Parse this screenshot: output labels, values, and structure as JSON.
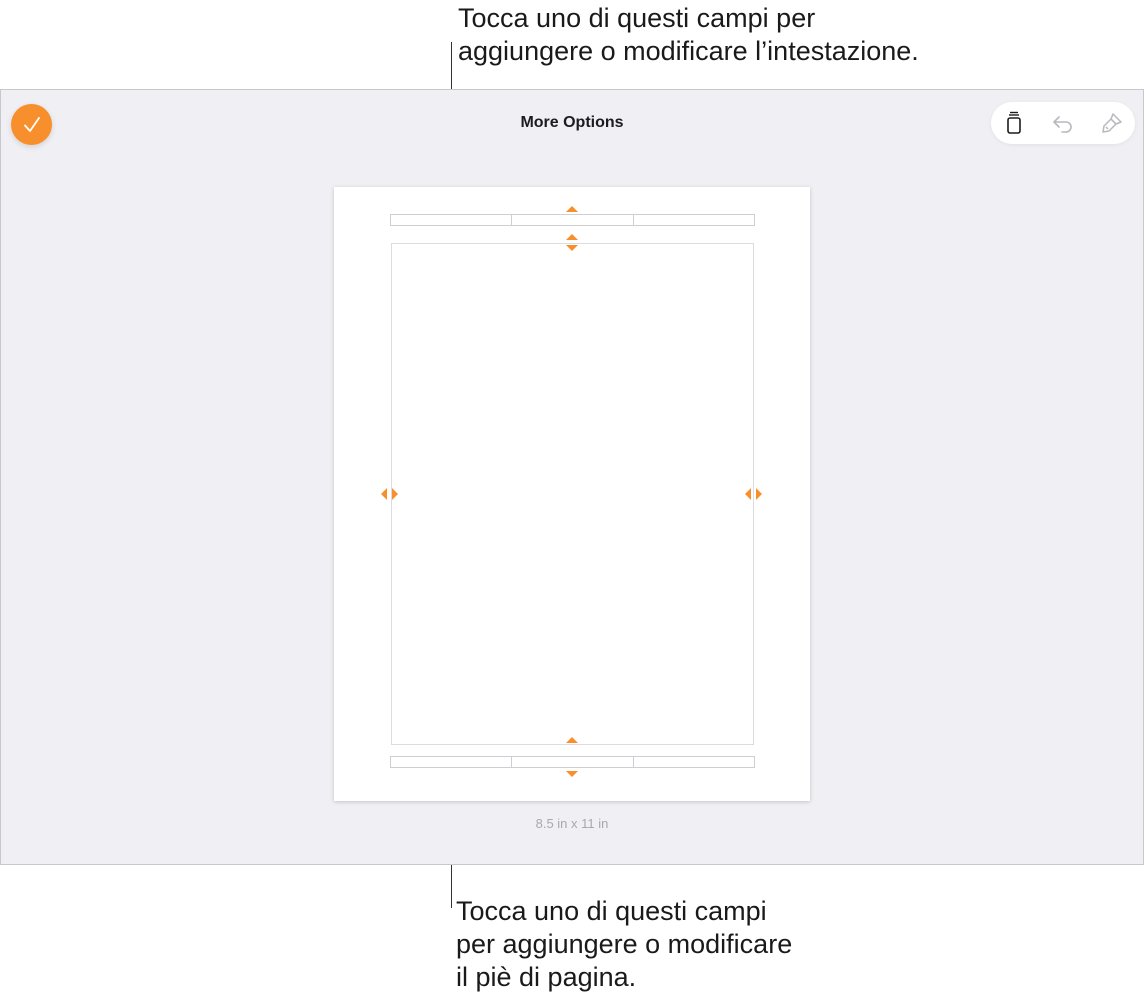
{
  "callouts": {
    "header_line1": "Tocca uno di questi campi per",
    "header_line2": "aggiungere o modificare l’intestazione.",
    "footer_line1": "Tocca uno di questi campi",
    "footer_line2": "per aggiungere o modificare",
    "footer_line3": "il piè di pagina."
  },
  "screen": {
    "title": "More Options",
    "page_size_label": "8.5 in x 11 in",
    "done_icon": "checkmark-icon",
    "toolbar_icons": [
      "clear-document-icon",
      "undo-icon",
      "format-brush-icon"
    ]
  },
  "page": {
    "header_fields": [
      "header-left",
      "header-center",
      "header-right"
    ],
    "footer_fields": [
      "footer-left",
      "footer-center",
      "footer-right"
    ]
  },
  "colors": {
    "accent": "#f7902c",
    "background": "#f0eff4",
    "page": "#ffffff"
  }
}
